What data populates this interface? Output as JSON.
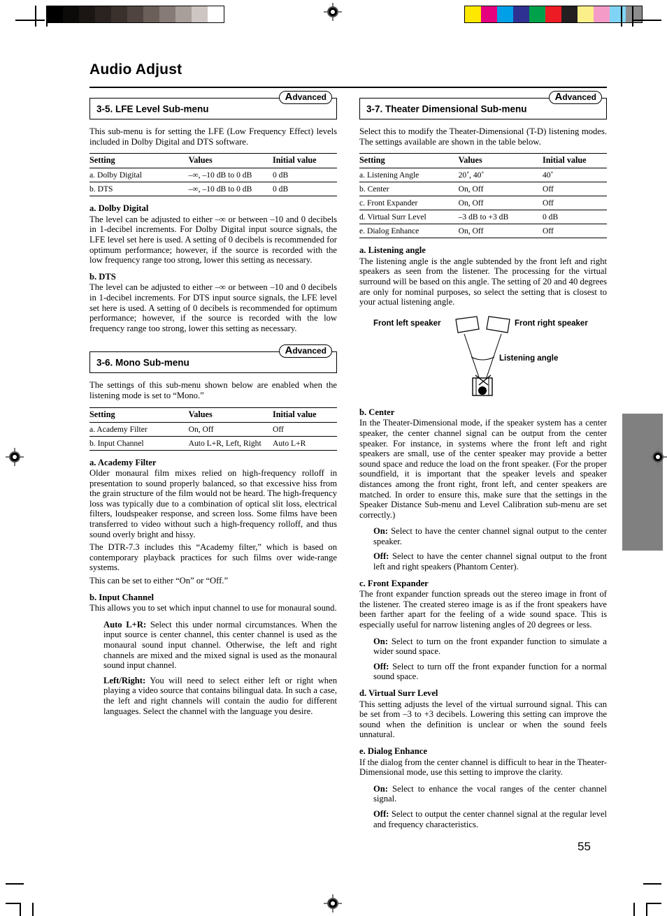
{
  "page": {
    "title": "Audio Adjust",
    "number": "55"
  },
  "calibration": {
    "grayscale": [
      "#000000",
      "#0d0a0a",
      "#1b1614",
      "#2a2320",
      "#3a312d",
      "#4f4440",
      "#6b5f5a",
      "#877b77",
      "#a89e9a",
      "#cec6c2",
      "#ffffff"
    ],
    "colors": [
      "#ffe800",
      "#e5007e",
      "#00a0e9",
      "#2e3192",
      "#00a14b",
      "#ed1c24",
      "#231f20",
      "#fbef8a",
      "#f59bc8",
      "#7fd4f5",
      "#8c8c8c"
    ]
  },
  "left_column": {
    "section_lfe": {
      "badge": "Advanced",
      "badge_cap": "A",
      "badge_rest": "dvanced",
      "heading": "3-5. LFE Level Sub-menu",
      "intro": "This sub-menu is for setting the LFE (Low Frequency Effect) levels included in Dolby Digital and DTS software.",
      "table": {
        "headers": [
          "Setting",
          "Values",
          "Initial value"
        ],
        "rows": [
          [
            "a. Dolby Digital",
            "–∞, –10 dB to 0 dB",
            "0 dB"
          ],
          [
            "b. DTS",
            "–∞, –10 dB to 0 dB",
            "0 dB"
          ]
        ]
      },
      "items": [
        {
          "heading": "a. Dolby Digital",
          "body": "The level can be adjusted to either –∞ or between –10 and 0 decibels in 1-decibel increments. For Dolby Digital input source signals, the LFE level set here is used. A setting of 0 decibels is recommended for optimum performance; however, if the source is recorded with the low frequency range too strong, lower this setting as necessary."
        },
        {
          "heading": "b. DTS",
          "body": "The level can be adjusted to either –∞ or between –10 and 0 decibels in 1-decibel increments. For DTS input source signals, the LFE level set here is used. A setting of 0 decibels is recommended for optimum performance; however, if the source is recorded with the low frequency range too strong, lower this setting as necessary."
        }
      ]
    },
    "section_mono": {
      "badge": "Advanced",
      "badge_cap": "A",
      "badge_rest": "dvanced",
      "heading": "3-6. Mono Sub-menu",
      "intro": "The settings of this sub-menu shown below are enabled when the listening mode is set to “Mono.”",
      "table": {
        "headers": [
          "Setting",
          "Values",
          "Initial value"
        ],
        "rows": [
          [
            "a. Academy Filter",
            "On, Off",
            "Off"
          ],
          [
            "b. Input Channel",
            "Auto L+R, Left, Right",
            "Auto L+R"
          ]
        ]
      },
      "academy": {
        "heading": "a. Academy Filter",
        "para1": "Older monaural film mixes relied on high-frequency rolloff in presentation to sound properly balanced, so that excessive hiss from the grain structure of the film would not be heard. The high-frequency loss was typically due to a combination of optical slit loss, electrical filters, loudspeaker response, and screen loss. Some films have been transferred to video without such a high-frequency rolloff, and thus sound overly bright and hissy.",
        "para2": "The DTR-7.3 includes this “Academy filter,” which is based on contemporary playback practices for such films over wide-range systems.",
        "para3": "This can be set to either “On” or “Off.”"
      },
      "input_channel": {
        "heading": "b. Input Channel",
        "body": "This allows you to set which input channel to use for monaural sound.",
        "options": [
          {
            "label": "Auto L+R:",
            "text": " Select this under normal circumstances. When the input source is center channel, this center channel is used as the monaural sound input channel. Otherwise, the left and right channels are mixed and the mixed signal is used as the monaural sound input channel."
          },
          {
            "label": "Left/Right:",
            "text": " You will need to select either left or right when playing a video source that contains bilingual data. In such a case, the left and right channels will contain the audio for different languages. Select the channel with the language you desire."
          }
        ]
      }
    }
  },
  "right_column": {
    "section_td": {
      "badge": "Advanced",
      "badge_cap": "A",
      "badge_rest": "dvanced",
      "heading": "3-7. Theater Dimensional Sub-menu",
      "intro": "Select this to modify the Theater-Dimensional (T-D) listening modes. The settings available are shown in the table below.",
      "table": {
        "headers": [
          "Setting",
          "Values",
          "Initial value"
        ],
        "rows": [
          [
            "a. Listening Angle",
            "20˚, 40˚",
            "40˚"
          ],
          [
            "b. Center",
            "On, Off",
            "Off"
          ],
          [
            "c. Front Expander",
            "On, Off",
            "Off"
          ],
          [
            "d. Virtual Surr Level",
            "–3 dB to +3 dB",
            "0 dB"
          ],
          [
            "e. Dialog Enhance",
            "On, Off",
            "Off"
          ]
        ]
      },
      "listening_angle": {
        "heading": "a. Listening angle",
        "body": "The listening angle is the angle subtended by the front left and right speakers as seen from the listener. The processing for the virtual surround will be based on this angle. The setting of 20 and 40 degrees are only for nominal purposes, so select the setting that is closest to your actual listening angle."
      },
      "diagram": {
        "label_left": "Front left speaker",
        "label_right": "Front right speaker",
        "label_angle": "Listening angle"
      },
      "center": {
        "heading": "b. Center",
        "body": "In the Theater-Dimensional mode, if the speaker system has a center speaker, the center channel signal can be output from the center speaker. For instance, in systems where the front left and right speakers are small, use of the center speaker may provide a better sound space and reduce the load on the front speaker. (For the proper soundfield, it is important that the speaker levels and speaker distances among the front right, front left, and center speakers are matched. In order to ensure this, make sure that the settings in the Speaker Distance Sub-menu and Level Calibration sub-menu are set correctly.)",
        "options": [
          {
            "label": "On:",
            "text": " Select to have the center channel signal output to the center speaker."
          },
          {
            "label": "Off:",
            "text": " Select to have the center channel signal output to the front left and right speakers (Phantom Center)."
          }
        ]
      },
      "front_expander": {
        "heading": "c. Front Expander",
        "body": "The front expander function spreads out the stereo image in front of the listener. The created stereo image is as if the front speakers have been farther apart for the feeling of a wide sound space. This is especially useful for narrow listening angles of 20 degrees or less.",
        "options": [
          {
            "label": "On:",
            "text": " Select to turn on the front expander function to simulate a wider sound space."
          },
          {
            "label": "Off:",
            "text": " Select to turn off the front expander function for a normal sound space."
          }
        ]
      },
      "virtual_surr": {
        "heading": "d. Virtual Surr Level",
        "body": "This setting adjusts the level of the virtual surround signal. This can be set from –3 to +3 decibels. Lowering this setting can improve the sound when the definition is unclear or when the sound feels unnatural."
      },
      "dialog_enhance": {
        "heading": "e. Dialog Enhance",
        "body": "If the dialog from the center channel is difficult to hear in the Theater-Dimensional mode, use this setting to improve the clarity.",
        "options": [
          {
            "label": "On:",
            "text": " Select to enhance the vocal ranges of the center channel signal."
          },
          {
            "label": "Off:",
            "text": " Select to output the center channel signal at the regular level and frequency characteristics."
          }
        ]
      }
    }
  }
}
